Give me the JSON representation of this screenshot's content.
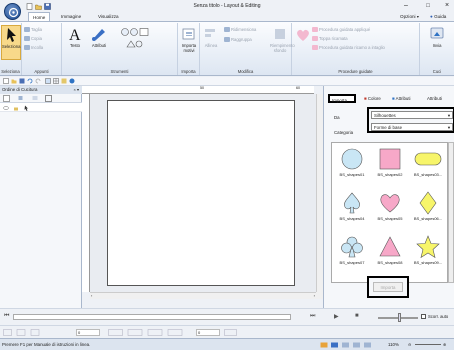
{
  "window": {
    "title": "Senza titolo - Layout & Editing",
    "minimize": "–",
    "maximize": "□",
    "close": "×",
    "options_label": "Opzioni",
    "help_label": "Guida"
  },
  "tabs": [
    "Home",
    "Immagine",
    "Visualizza"
  ],
  "ribbon": {
    "groups": {
      "seleziona": "Seleziona",
      "appunti": "Appunti",
      "strumenti": "Strumenti",
      "importa": "Importa",
      "modifica": "Modifica",
      "procedure": "Procedure guidate",
      "cuci": "Cuci"
    },
    "buttons": {
      "seleziona": "Seleziona",
      "taglia": "Taglia",
      "copia": "Copia",
      "incolla": "Incolla",
      "testo": "Testo",
      "attributi": "Attributi",
      "importa_motivi": "Importa motivi",
      "allinea": "Allinea",
      "ridimensiona": "Ridimensiona",
      "raggruppa": "Raggruppa",
      "riempimento": "Riempimento sfondo",
      "proc_applique": "Procedura guidata appliqué",
      "toppa": "Toppa ricamata",
      "proc_ricamo": "Procedura guidata ricamo a intaglio",
      "invia": "Invia"
    }
  },
  "left_panel": {
    "title": "Ordine di Cucitura"
  },
  "ruler_marks": [
    "50",
    "60"
  ],
  "right_panel": {
    "tabs": [
      "Importa",
      "Colore",
      "Attributi",
      "Attributi"
    ],
    "da_label": "Da",
    "da_value": "Silhouettes",
    "categoria_label": "Categoria",
    "categoria_value": "Forme di base",
    "shapes": [
      "BS_shapes01",
      "BS_shapes02",
      "BS_shapes03...",
      "BS_shapes04",
      "BS_shapes05",
      "BS_shapes06...",
      "BS_shapes07",
      "BS_shapes08",
      "BS_shapes09..."
    ],
    "import_button": "Importa"
  },
  "playbar": {
    "scroll_label": "Scorr. auto"
  },
  "bottombar": {
    "value1": "0",
    "value2": "0"
  },
  "status": {
    "text": "Premere F1 per Manuale di istruzioni in linea.",
    "zoom": "110%"
  },
  "colors": {
    "shape_blue": "#c9e6f5",
    "shape_pink": "#f7a8c8",
    "shape_yellow": "#f7f56a"
  }
}
